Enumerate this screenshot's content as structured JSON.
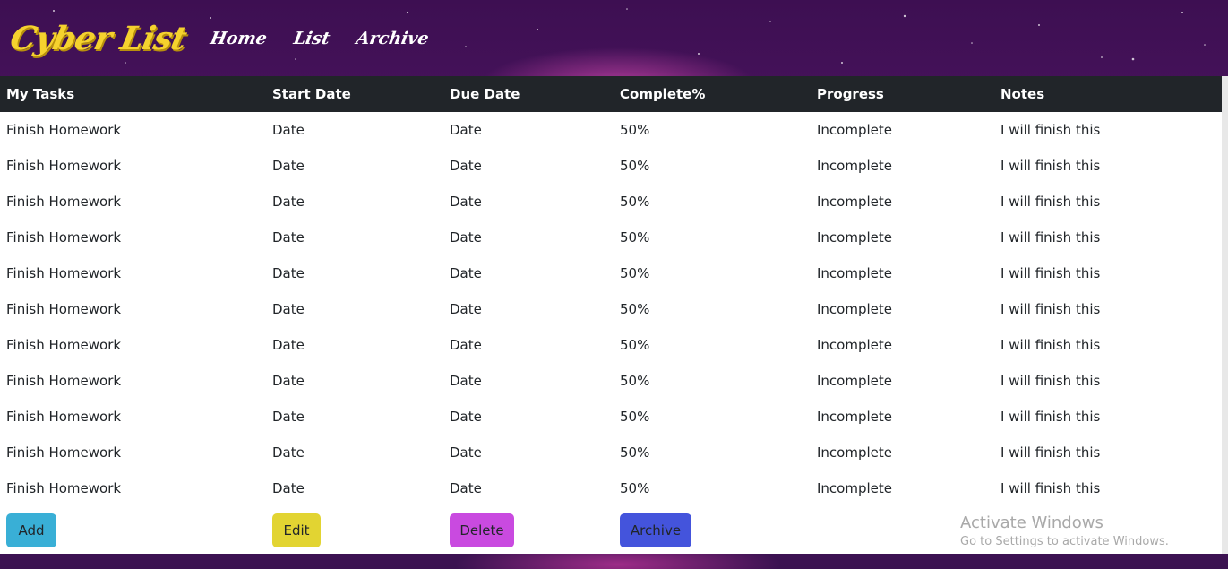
{
  "nav": {
    "logo": "Cyber List",
    "links": [
      "Home",
      "List",
      "Archive"
    ]
  },
  "table": {
    "headers": [
      "My Tasks",
      "Start Date",
      "Due Date",
      "Complete%",
      "Progress",
      "Notes"
    ],
    "rows": [
      [
        "Finish Homework",
        "Date",
        "Date",
        "50%",
        "Incomplete",
        "I will finish this"
      ],
      [
        "Finish Homework",
        "Date",
        "Date",
        "50%",
        "Incomplete",
        "I will finish this"
      ],
      [
        "Finish Homework",
        "Date",
        "Date",
        "50%",
        "Incomplete",
        "I will finish this"
      ],
      [
        "Finish Homework",
        "Date",
        "Date",
        "50%",
        "Incomplete",
        "I will finish this"
      ],
      [
        "Finish Homework",
        "Date",
        "Date",
        "50%",
        "Incomplete",
        "I will finish this"
      ],
      [
        "Finish Homework",
        "Date",
        "Date",
        "50%",
        "Incomplete",
        "I will finish this"
      ],
      [
        "Finish Homework",
        "Date",
        "Date",
        "50%",
        "Incomplete",
        "I will finish this"
      ],
      [
        "Finish Homework",
        "Date",
        "Date",
        "50%",
        "Incomplete",
        "I will finish this"
      ],
      [
        "Finish Homework",
        "Date",
        "Date",
        "50%",
        "Incomplete",
        "I will finish this"
      ],
      [
        "Finish Homework",
        "Date",
        "Date",
        "50%",
        "Incomplete",
        "I will finish this"
      ],
      [
        "Finish Homework",
        "Date",
        "Date",
        "50%",
        "Incomplete",
        "I will finish this"
      ]
    ]
  },
  "actions": {
    "add": "Add",
    "edit": "Edit",
    "delete": "Delete",
    "archive": "Archive"
  },
  "colors": {
    "logo": "#f5d22e",
    "table_header_bg": "#212529",
    "add": "#39afd6",
    "edit": "#e2d432",
    "delete": "#c94ae0",
    "archive": "#4454dc"
  },
  "watermark": {
    "title": "Activate Windows",
    "subtitle": "Go to Settings to activate Windows."
  }
}
